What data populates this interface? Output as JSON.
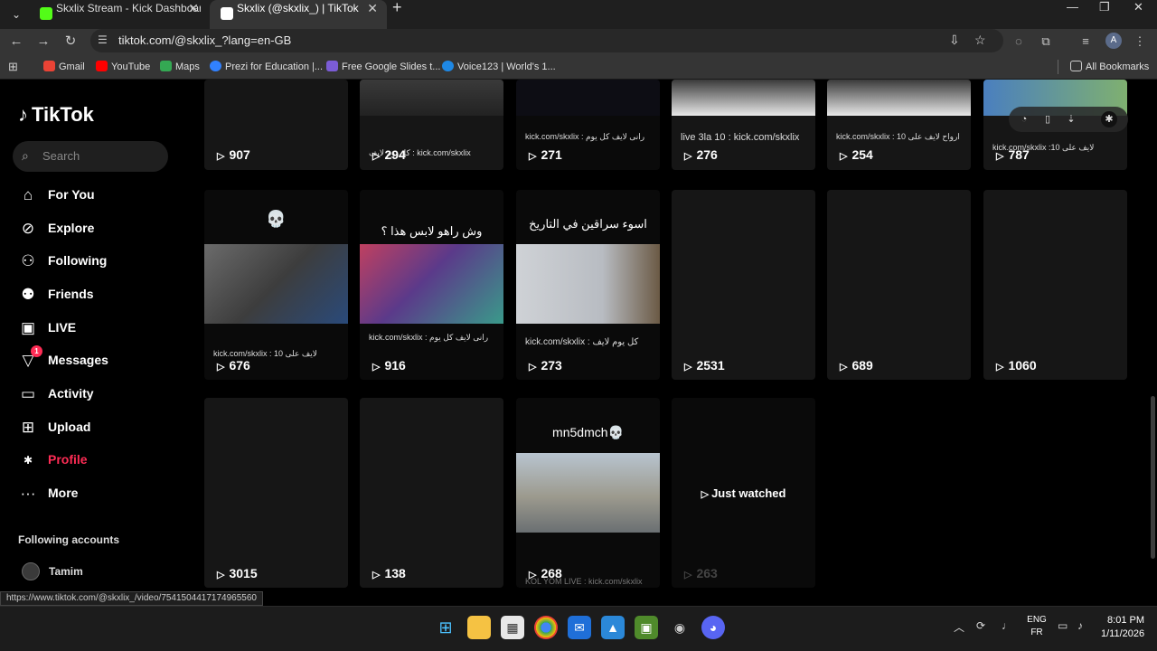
{
  "browser": {
    "tabs": [
      {
        "label": "Skxlix Stream - Kick Dashboard",
        "favicon_color": "#53fc18"
      },
      {
        "label": "Skxlix (@skxlix_) | TikTok",
        "favicon_color": "#ffffff"
      }
    ],
    "url": "tiktok.com/@skxlix_?lang=en-GB",
    "profile_initial": "A",
    "bookmarks": [
      {
        "label": "Gmail",
        "color": "#ea4335"
      },
      {
        "label": "YouTube",
        "color": "#ff0000"
      },
      {
        "label": "Maps",
        "color": "#34a853"
      },
      {
        "label": "Prezi for Education |...",
        "color": "#3181ff"
      },
      {
        "label": "Free Google Slides t...",
        "color": "#7b5cd6"
      },
      {
        "label": "Voice123 | World's 1...",
        "color": "#1e88e5"
      }
    ],
    "all_bookmarks": "All Bookmarks"
  },
  "tiktok": {
    "logo": "TikTok",
    "search_placeholder": "Search",
    "nav": [
      {
        "label": "For You",
        "icon": "home-icon"
      },
      {
        "label": "Explore",
        "icon": "compass-icon"
      },
      {
        "label": "Following",
        "icon": "person-plus-icon"
      },
      {
        "label": "Friends",
        "icon": "friends-icon"
      },
      {
        "label": "LIVE",
        "icon": "live-icon"
      },
      {
        "label": "Messages",
        "icon": "messages-icon",
        "badge": "1"
      },
      {
        "label": "Activity",
        "icon": "activity-icon"
      },
      {
        "label": "Upload",
        "icon": "upload-icon"
      },
      {
        "label": "Profile",
        "icon": "profile-avatar-icon",
        "active": true
      },
      {
        "label": "More",
        "icon": "more-icon"
      }
    ],
    "following_accounts_title": "Following accounts",
    "following_accounts": [
      {
        "name": "Tamim"
      }
    ],
    "videos": {
      "row1": [
        {
          "views": "907",
          "caption": ""
        },
        {
          "views": "294",
          "caption": "كل يوم لايف : kick.com/skxlix"
        },
        {
          "views": "271",
          "caption": "kick.com/skxlix : رانى لايف كل يوم"
        },
        {
          "views": "276",
          "caption": "live 3la 10 : kick.com/skxlix"
        },
        {
          "views": "254",
          "caption": "kick.com/skxlix : ارواح لايف على 10"
        },
        {
          "views": "787",
          "caption": "kick.com/skxlix :10 لايف على"
        }
      ],
      "row2": [
        {
          "views": "676",
          "title": "💀",
          "caption": "kick.com/skxlix : لايف على 10"
        },
        {
          "views": "916",
          "title": "وش راهو لابس هذا ؟",
          "caption": "kick.com/skxlix : رانى لايف كل يوم"
        },
        {
          "views": "273",
          "title": "اسوء سراقين في التاريخ",
          "caption": "kick.com/skxlix : كل يوم لايف"
        },
        {
          "views": "2531",
          "title": "",
          "caption": ""
        },
        {
          "views": "689",
          "title": "",
          "caption": ""
        },
        {
          "views": "1060",
          "title": "",
          "caption": ""
        }
      ],
      "row3": [
        {
          "views": "3015",
          "title": "",
          "caption": ""
        },
        {
          "views": "138",
          "title": "",
          "caption": ""
        },
        {
          "views": "268",
          "title": "mn5dmch💀",
          "caption": "KOL YOM LIVE : kick.com/skxlix"
        },
        {
          "views": "263",
          "title": "",
          "caption": "",
          "overlay": "Just watched"
        }
      ]
    }
  },
  "status_url": "https://www.tiktok.com/@skxlix_/video/7541504417174965560",
  "taskbar": {
    "lang_top": "ENG",
    "lang_bottom": "FR",
    "time": "8:01 PM",
    "date": "1/11/2026"
  }
}
